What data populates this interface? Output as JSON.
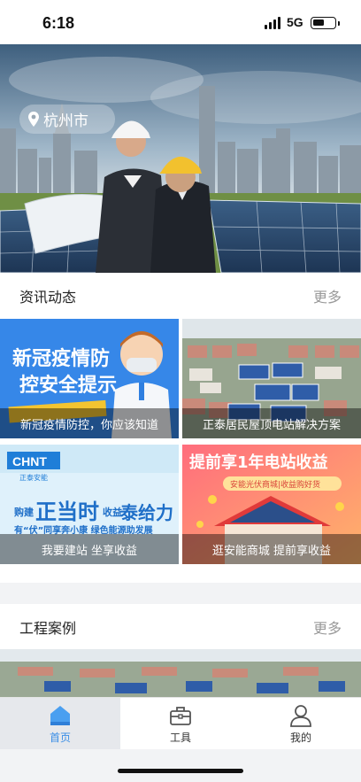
{
  "status": {
    "time": "6:18",
    "network": "5G"
  },
  "banner": {
    "location": "杭州市"
  },
  "news": {
    "title": "资讯动态",
    "more": "更多",
    "cards": [
      {
        "caption": "新冠疫情防控，你应该知道",
        "headline1": "新冠疫情防",
        "headline2": "控安全提示"
      },
      {
        "caption": "正泰居民屋顶电站解决方案"
      },
      {
        "caption": "我要建站 坐享收益",
        "brand": "CHNT",
        "brand_sub": "正泰安能",
        "slogan_a": "购建",
        "slogan_b": "正当时",
        "slogan_c": "收益",
        "slogan_d": "泰给力",
        "tagline": "有“伏”同享奔小康  绿色能源助发展"
      },
      {
        "caption": "逛安能商城 提前享收益",
        "headline": "提前享1年电站收益",
        "subline": "安能光伏商城|收益购好货"
      }
    ]
  },
  "cases": {
    "title": "工程案例",
    "more": "更多"
  },
  "tabs": [
    {
      "label": "首页",
      "icon": "home-icon"
    },
    {
      "label": "工具",
      "icon": "toolbox-icon"
    },
    {
      "label": "我的",
      "icon": "user-icon"
    }
  ],
  "colors": {
    "accent": "#3a8ee6",
    "background": "#f2f3f5"
  }
}
